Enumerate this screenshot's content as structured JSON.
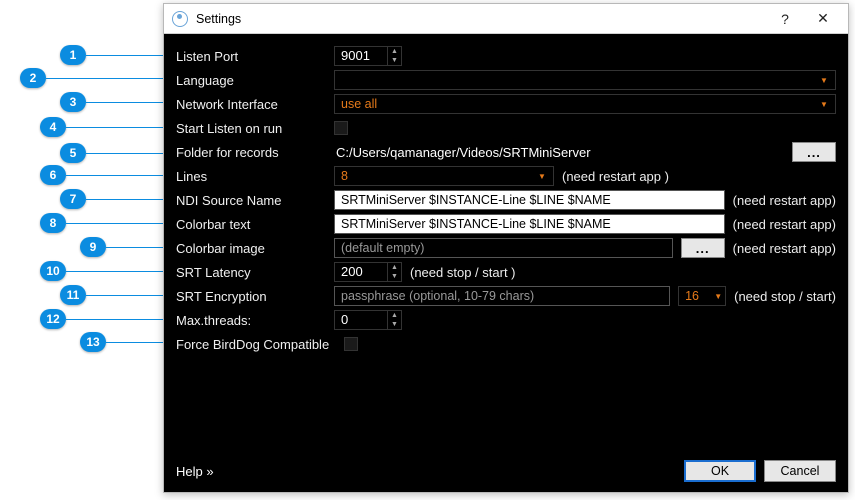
{
  "window": {
    "title": "Settings",
    "help_glyph": "?",
    "close_glyph": "✕"
  },
  "callouts": [
    "1",
    "2",
    "3",
    "4",
    "5",
    "6",
    "7",
    "8",
    "9",
    "10",
    "11",
    "12",
    "13"
  ],
  "fields": {
    "listen_port": {
      "label": "Listen Port",
      "value": "9001"
    },
    "language": {
      "label": "Language",
      "value": ""
    },
    "network_interface": {
      "label": "Network Interface",
      "value": "use all"
    },
    "start_listen": {
      "label": "Start Listen on run"
    },
    "folder": {
      "label": "Folder for records",
      "value": "C:/Users/qamanager/Videos/SRTMiniServer",
      "browse": "..."
    },
    "lines": {
      "label": "Lines",
      "value": "8",
      "note": "(need restart app )"
    },
    "ndi_source": {
      "label": "NDI Source Name",
      "value": "SRTMiniServer $INSTANCE-Line $LINE $NAME",
      "note": "(need restart app)"
    },
    "colorbar_text": {
      "label": "Colorbar text",
      "value": "SRTMiniServer $INSTANCE-Line $LINE $NAME",
      "note": "(need restart app)"
    },
    "colorbar_image": {
      "label": "Colorbar image",
      "placeholder": "(default empty)",
      "browse": "...",
      "note": "(need restart app)"
    },
    "srt_latency": {
      "label": "SRT Latency",
      "value": "200",
      "note": "(need stop / start )"
    },
    "srt_encryption": {
      "label": "SRT Encryption",
      "placeholder": "passphrase (optional, 10-79 chars)",
      "key": "16",
      "note": "(need stop / start)"
    },
    "max_threads": {
      "label": "Max.threads:",
      "value": "0"
    },
    "force_birddog": {
      "label": "Force BirdDog Compatible"
    }
  },
  "footer": {
    "help": "Help »",
    "ok": "OK",
    "cancel": "Cancel"
  }
}
